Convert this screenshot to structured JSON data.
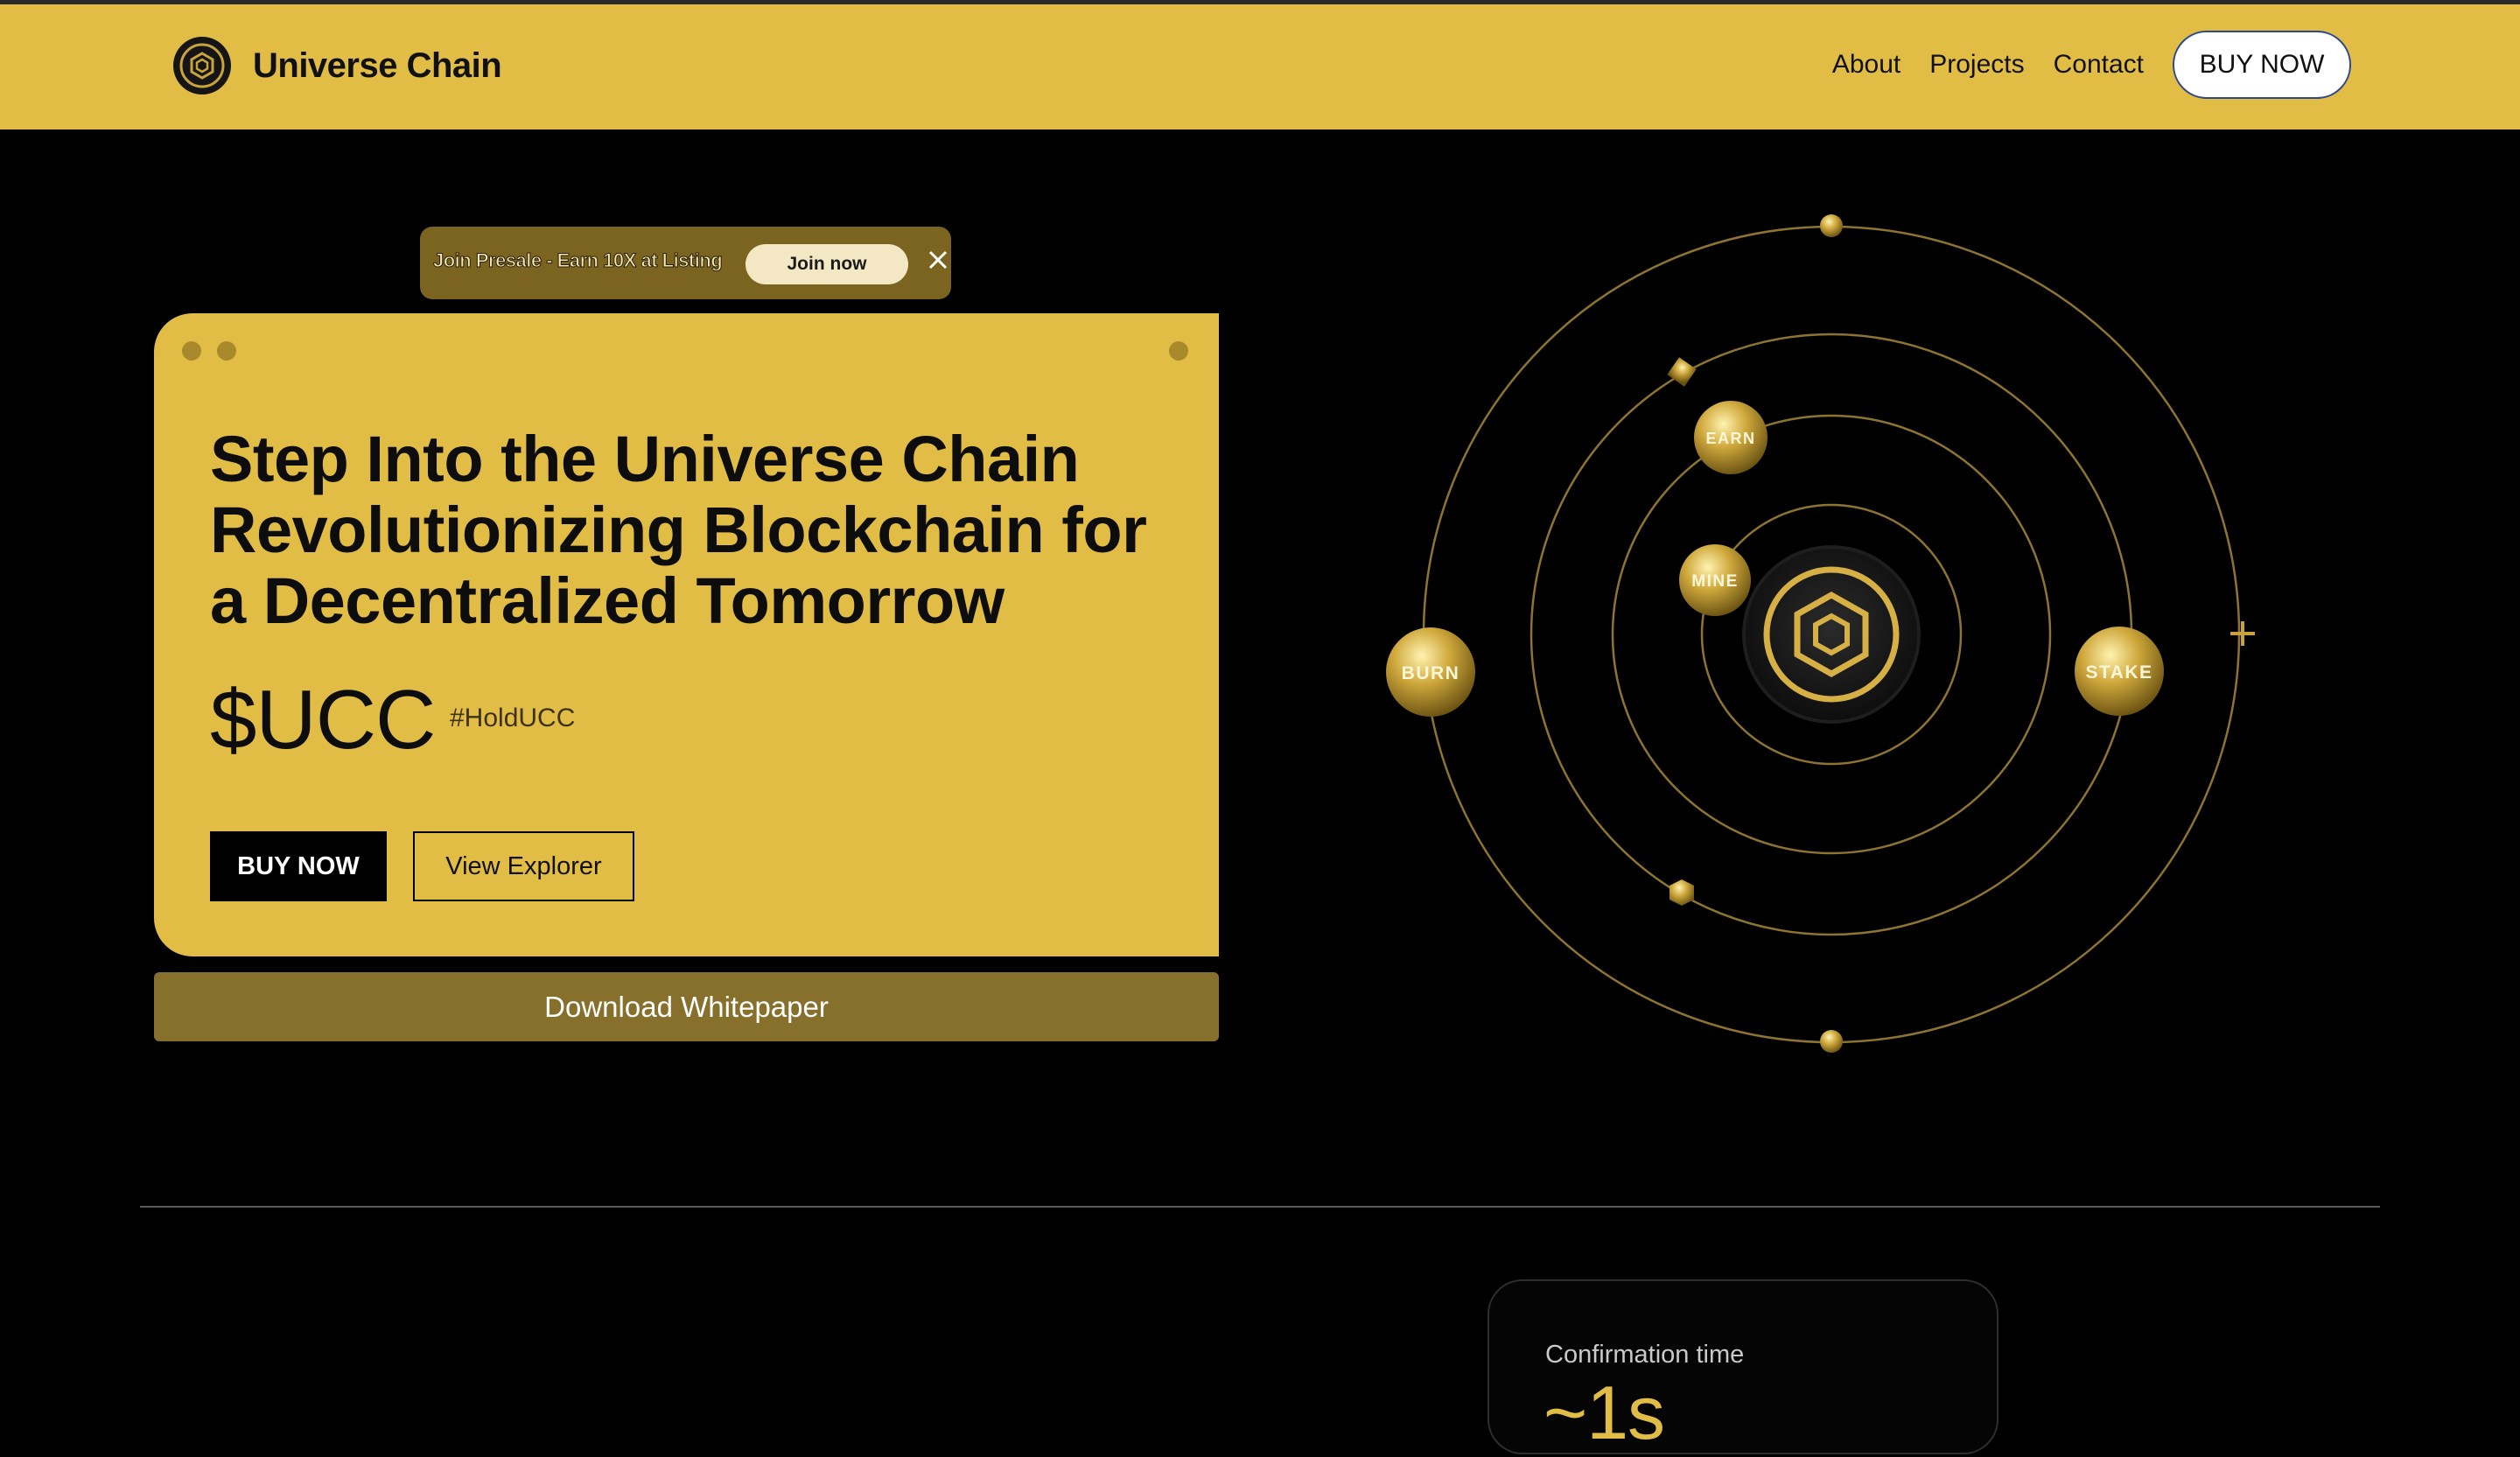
{
  "brand": {
    "name": "Universe Chain",
    "logo_icon": "hexagon-cube-icon"
  },
  "nav": {
    "links": [
      "About",
      "Projects",
      "Contact"
    ],
    "buy_label": "BUY NOW"
  },
  "presale": {
    "text": "Join Presale - Earn 10X at Listing",
    "join_label": "Join now",
    "close_icon": "close-icon"
  },
  "hero": {
    "headline": "Step Into the Universe Chain Revolutionizing Blockchain for a Decentralized Tomorrow",
    "ticker": "$UCC",
    "hashtag": "#HoldUCC",
    "buy_label": "BUY NOW",
    "explorer_label": "View Explorer",
    "whitepaper_label": "Download Whitepaper"
  },
  "orbit": {
    "planets": [
      "EARN",
      "MINE",
      "BURN",
      "STAKE"
    ],
    "center_icon": "hexagon-cube-icon"
  },
  "stats": {
    "label": "Confirmation time",
    "value": "~1s"
  },
  "colors": {
    "brand_gold": "#e2bd46",
    "dark_gold": "#86702b",
    "background": "#000000"
  }
}
